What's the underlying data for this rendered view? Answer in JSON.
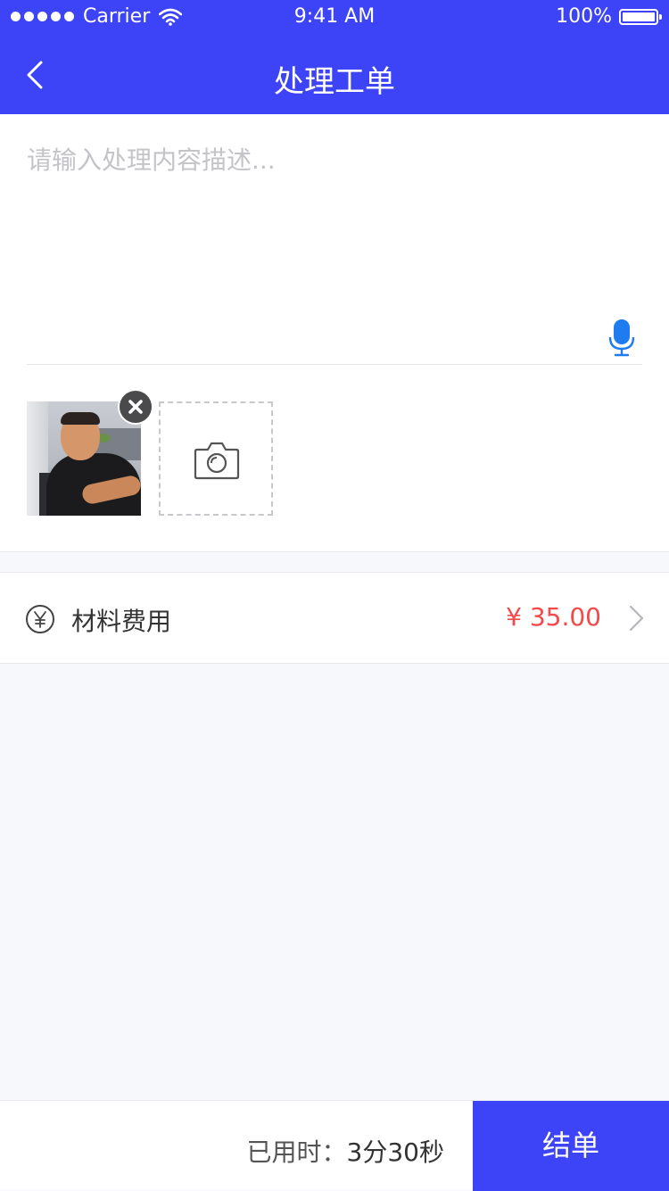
{
  "status_bar": {
    "carrier": "Carrier",
    "time": "9:41 AM",
    "battery": "100%"
  },
  "nav": {
    "title": "处理工单",
    "back_icon": "chevron-left-icon"
  },
  "description": {
    "placeholder": "请输入处理内容描述...",
    "value": "",
    "mic_icon": "microphone-icon"
  },
  "photos": {
    "count": 1,
    "remove_icon": "close-icon",
    "add_icon": "camera-icon"
  },
  "material_fee": {
    "label": "材料费用",
    "amount": "¥ 35.00",
    "icon": "yen-icon"
  },
  "footer": {
    "elapsed_label": "已用时：",
    "elapsed_value": "3分30秒",
    "finish_label": "结单"
  },
  "colors": {
    "primary": "#3d43f6",
    "price": "#f4484a",
    "background": "#f7f8fc",
    "mic": "#1e7cf0"
  }
}
